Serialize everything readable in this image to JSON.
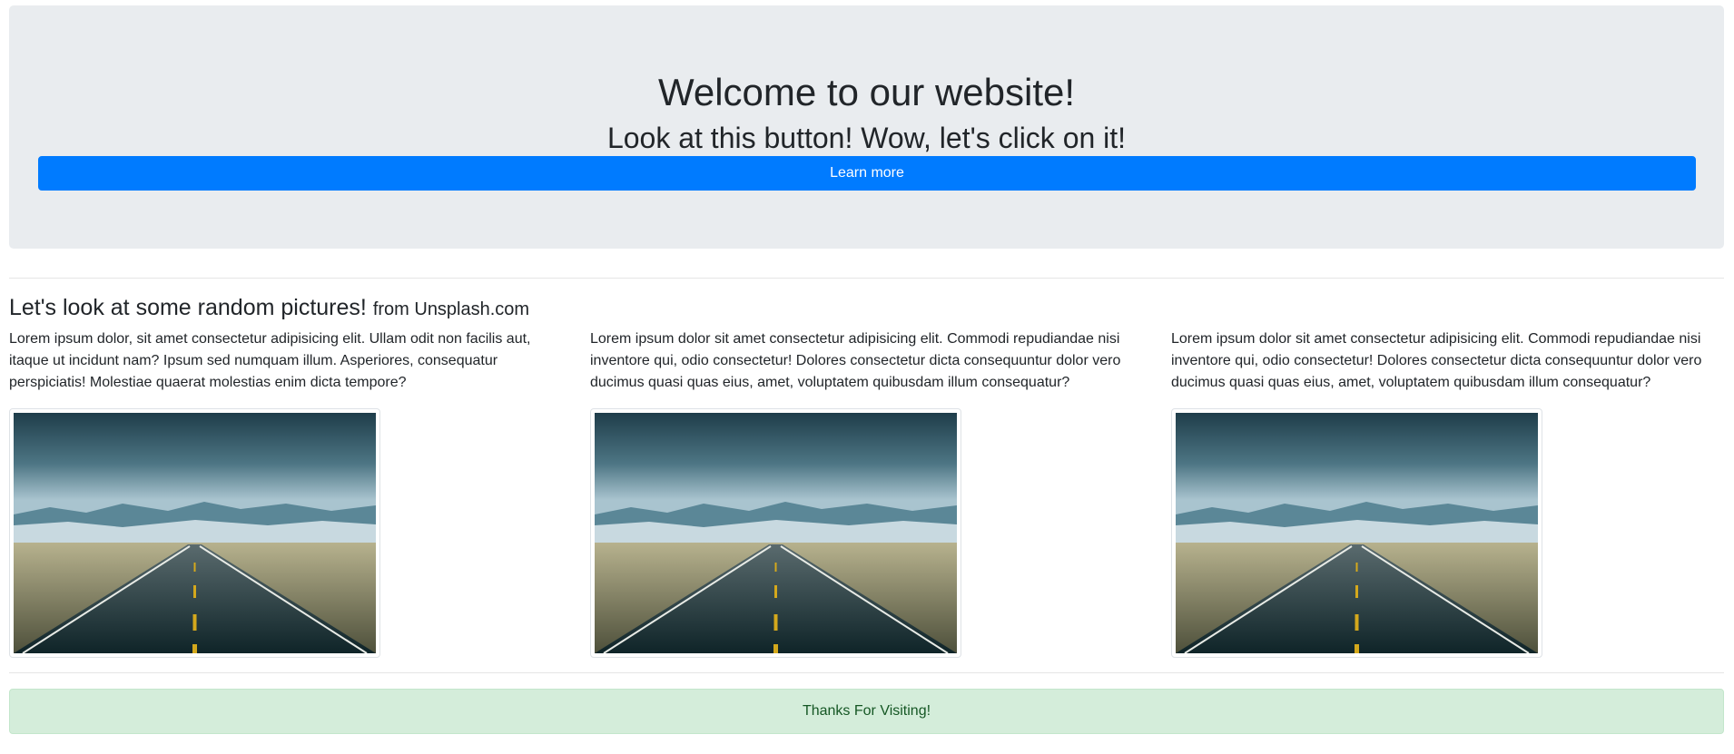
{
  "hero": {
    "title": "Welcome to our website!",
    "subtitle": "Look at this button! Wow, let's click on it!",
    "button_label": "Learn more"
  },
  "gallery": {
    "title": "Let's look at some random pictures!",
    "title_small": "from Unsplash.com",
    "columns": [
      {
        "text": "Lorem ipsum dolor, sit amet consectetur adipisicing elit. Ullam odit non facilis aut, itaque ut incidunt nam? Ipsum sed numquam illum. Asperiores, consequatur perspiciatis! Molestiae quaerat molestias enim dicta tempore?",
        "image": "road-landscape-photo"
      },
      {
        "text": "Lorem ipsum dolor sit amet consectetur adipisicing elit. Commodi repudiandae nisi inventore qui, odio consectetur! Dolores consectetur dicta consequuntur dolor vero ducimus quasi quas eius, amet, voluptatem quibusdam illum consequatur?",
        "image": "road-landscape-photo"
      },
      {
        "text": "Lorem ipsum dolor sit amet consectetur adipisicing elit. Commodi repudiandae nisi inventore qui, odio consectetur! Dolores consectetur dicta consequuntur dolor vero ducimus quasi quas eius, amet, voluptatem quibusdam illum consequatur?",
        "image": "road-landscape-photo"
      }
    ]
  },
  "footer": {
    "message": "Thanks For Visiting!"
  },
  "colors": {
    "primary": "#007bff",
    "jumbotron_bg": "#e9ecef",
    "success_bg": "#d4edda",
    "success_text": "#155724"
  }
}
